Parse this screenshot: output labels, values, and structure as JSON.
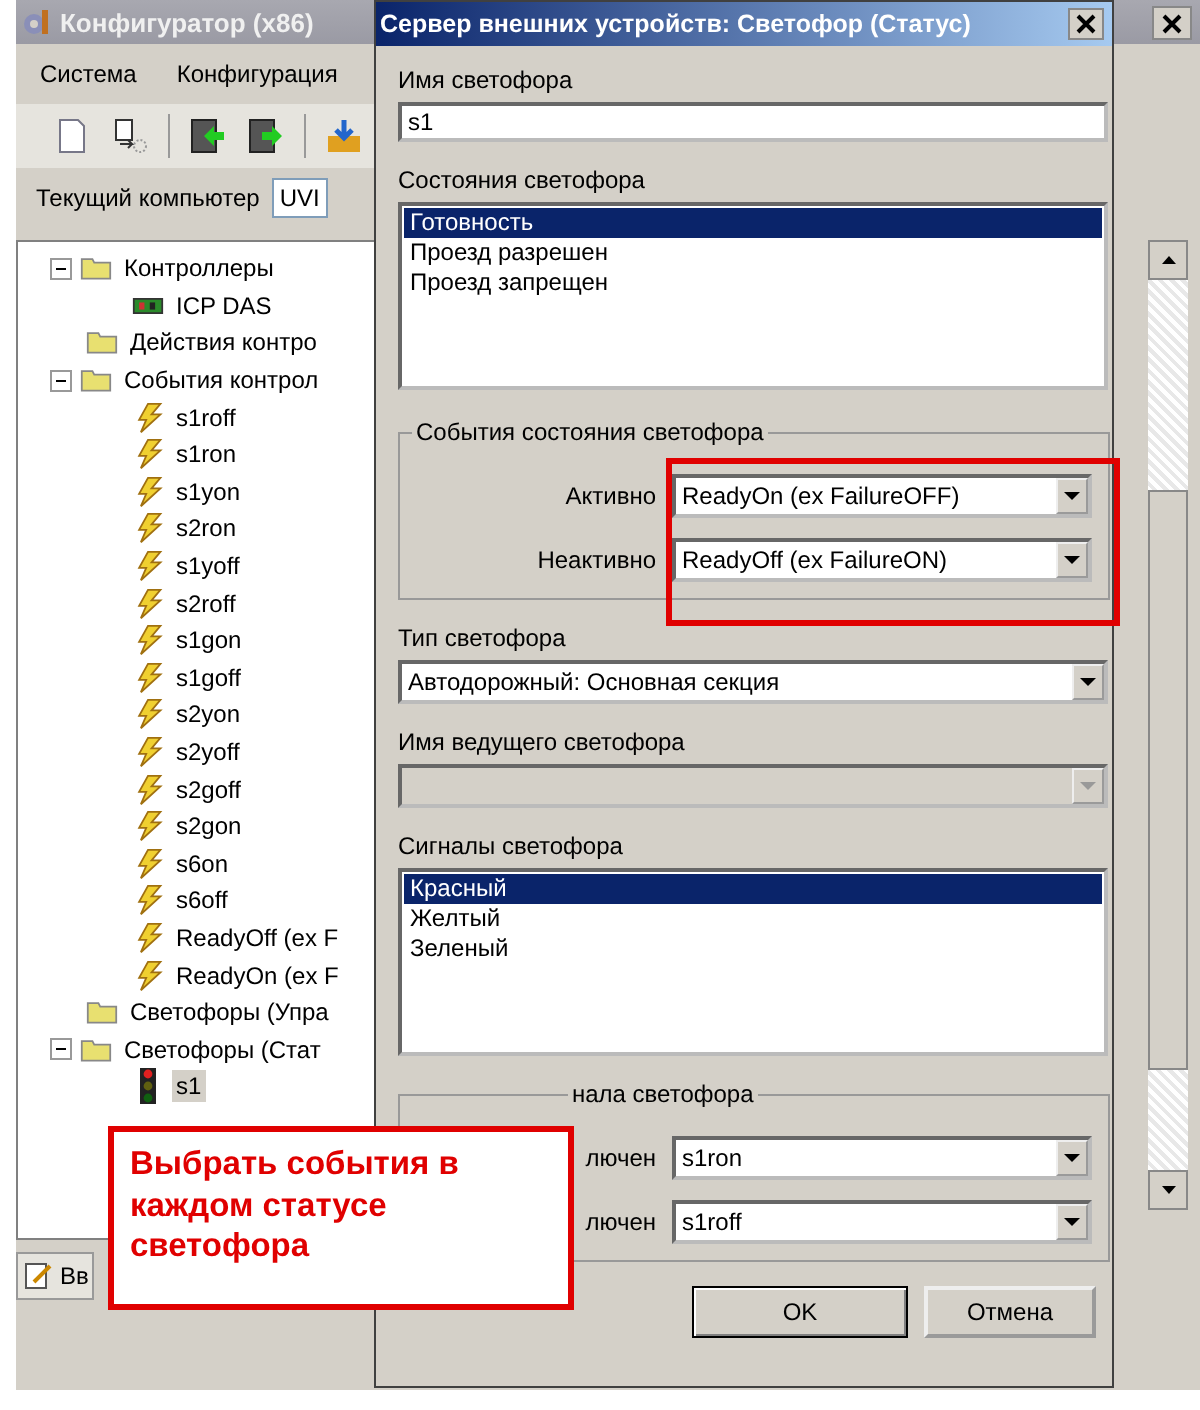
{
  "app": {
    "title": "Конфигуратор (x86)",
    "menu": [
      "Система",
      "Конфигурация"
    ],
    "computer_label": "Текущий компьютер",
    "computer_value": "UVI",
    "tree": [
      {
        "label": "Контроллеры",
        "kind": "folder",
        "expanded": true,
        "selected": false,
        "children": [
          {
            "label": "ICP DAS",
            "kind": "device",
            "selected": false
          }
        ]
      },
      {
        "label": "Действия контро",
        "kind": "folder",
        "selected": false
      },
      {
        "label": "События контрол",
        "kind": "folder",
        "expanded": true,
        "selected": false,
        "children": [
          {
            "label": "s1roff",
            "kind": "event",
            "selected": false
          },
          {
            "label": "s1ron",
            "kind": "event",
            "selected": false
          },
          {
            "label": "s1yon",
            "kind": "event",
            "selected": false
          },
          {
            "label": "s2ron",
            "kind": "event",
            "selected": false
          },
          {
            "label": "s1yoff",
            "kind": "event",
            "selected": false
          },
          {
            "label": "s2roff",
            "kind": "event",
            "selected": false
          },
          {
            "label": "s1gon",
            "kind": "event",
            "selected": false
          },
          {
            "label": "s1goff",
            "kind": "event",
            "selected": false
          },
          {
            "label": "s2yon",
            "kind": "event",
            "selected": false
          },
          {
            "label": "s2yoff",
            "kind": "event",
            "selected": false
          },
          {
            "label": "s2goff",
            "kind": "event",
            "selected": false
          },
          {
            "label": "s2gon",
            "kind": "event",
            "selected": false
          },
          {
            "label": "s6on",
            "kind": "event",
            "selected": false
          },
          {
            "label": "s6off",
            "kind": "event",
            "selected": false
          },
          {
            "label": "ReadyOff (ex F",
            "kind": "event",
            "selected": false
          },
          {
            "label": "ReadyOn (ex F",
            "kind": "event",
            "selected": false
          }
        ]
      },
      {
        "label": "Светофоры (Упра",
        "kind": "folder",
        "selected": false
      },
      {
        "label": "Светофоры (Стат",
        "kind": "folder",
        "expanded": true,
        "selected": false,
        "children": [
          {
            "label": "s1",
            "kind": "light",
            "selected": true
          }
        ]
      }
    ],
    "bottom_tab": "Вв"
  },
  "dialog": {
    "title": "Сервер внешних устройств: Светофор (Статус)",
    "name_label": "Имя светофора",
    "name_value": "s1",
    "states_label": "Состояния светофора",
    "states": [
      {
        "label": "Готовность",
        "selected": true
      },
      {
        "label": "Проезд разрешен",
        "selected": false
      },
      {
        "label": "Проезд запрещен",
        "selected": false
      }
    ],
    "state_events": {
      "title": "События состояния светофора",
      "rows": [
        {
          "label": "Активно",
          "value": "ReadyOn (ex FailureOFF)"
        },
        {
          "label": "Неактивно",
          "value": "ReadyOff (ex FailureON)"
        }
      ]
    },
    "type_label": "Тип светофора",
    "type_value": "Автодорожный: Основная секция",
    "leader_label": "Имя ведущего светофора",
    "leader_disabled": true,
    "signals_label": "Сигналы светофора",
    "signals": [
      {
        "label": "Красный",
        "selected": true
      },
      {
        "label": "Желтый",
        "selected": false
      },
      {
        "label": "Зеленый",
        "selected": false
      }
    ],
    "signal_events": {
      "title": "нала светофора",
      "rows": [
        {
          "label": "лючен",
          "value": "s1ron"
        },
        {
          "label": "лючен",
          "value": "s1roff"
        }
      ]
    },
    "buttons": [
      "OK",
      "Отмена"
    ]
  },
  "callout": {
    "text": "Выбрать события в каждом статусе светофора"
  }
}
